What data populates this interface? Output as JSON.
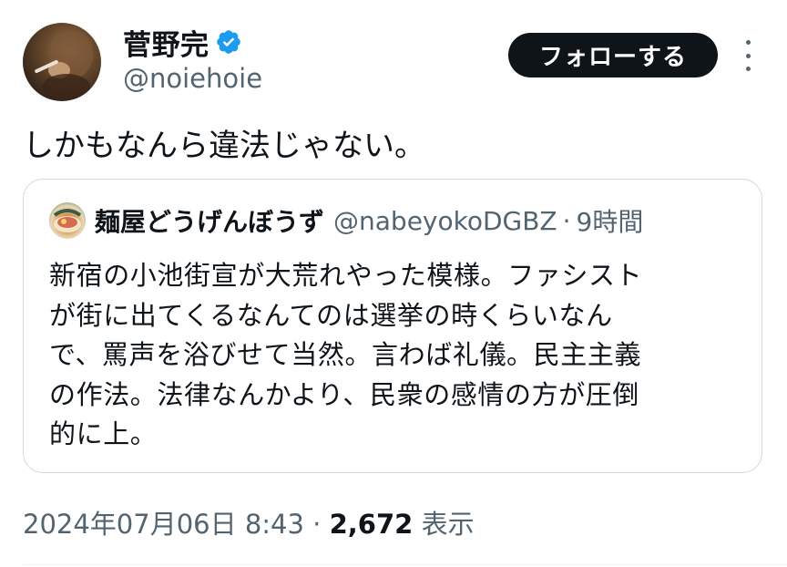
{
  "author": {
    "display_name": "菅野完",
    "handle": "@noiehoie",
    "verified": true,
    "verified_color": "#1d9bf0"
  },
  "actions": {
    "follow_label": "フォローする",
    "more_icon": "more-vertical-icon"
  },
  "tweet": {
    "text": "しかもなんら違法じゃない。"
  },
  "quote": {
    "display_name": "麺屋どうげんぼうず",
    "handle": "@nabeyokoDGBZ",
    "separator": "·",
    "time": "9時間",
    "lines": [
      "新宿の小池街宣が大荒れやった模様。ファシスト",
      "が街に出てくるなんてのは選挙の時くらいなん",
      "で、罵声を浴びせて当然。言わば礼儀。民主主義",
      "の作法。法律なんかより、民衆の感情の方が圧倒",
      "的に上。"
    ]
  },
  "meta": {
    "timestamp": "2024年07月06日 8:43",
    "separator": "·",
    "views_count": "2,672",
    "views_label": "表示"
  },
  "colors": {
    "text_primary": "#0f1419",
    "text_secondary": "#536471",
    "border": "#cfd9de",
    "button_bg": "#0f1419",
    "button_text": "#ffffff"
  }
}
